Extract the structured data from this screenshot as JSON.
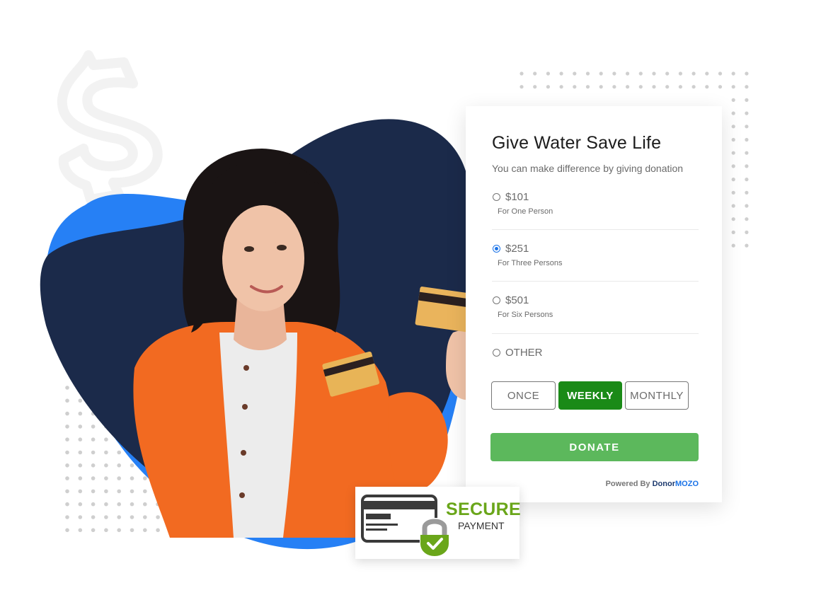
{
  "form": {
    "title": "Give Water Save Life",
    "subtitle": "You can make difference by giving donation",
    "options": [
      {
        "amount": "$101",
        "description": "For One Person",
        "selected": false
      },
      {
        "amount": "$251",
        "description": "For Three Persons",
        "selected": true
      },
      {
        "amount": "$501",
        "description": "For Six Persons",
        "selected": false
      },
      {
        "amount": "OTHER",
        "description": "",
        "selected": false
      }
    ],
    "frequency": {
      "options": [
        "ONCE",
        "WEEKLY",
        "MONTHLY"
      ],
      "selected": "WEEKLY"
    },
    "donate_label": "DONATE",
    "powered_by": {
      "prefix": "Powered By ",
      "brand_part1": "Donor",
      "brand_part2": "MOZO"
    }
  },
  "badge": {
    "title": "SECURE",
    "subtitle": "PAYMENT",
    "icons": [
      "credit-card-icon",
      "padlock-check-icon"
    ]
  },
  "decor": {
    "icons": [
      "dollar-sign-outline"
    ],
    "colors": {
      "blob_dark": "#1b2a4a",
      "blob_blue": "#2680f5",
      "jacket": "#f26a21",
      "selected_frequency": "#1a8a17",
      "donate_button": "#5cb85c",
      "secure_green": "#6aa61a"
    }
  }
}
